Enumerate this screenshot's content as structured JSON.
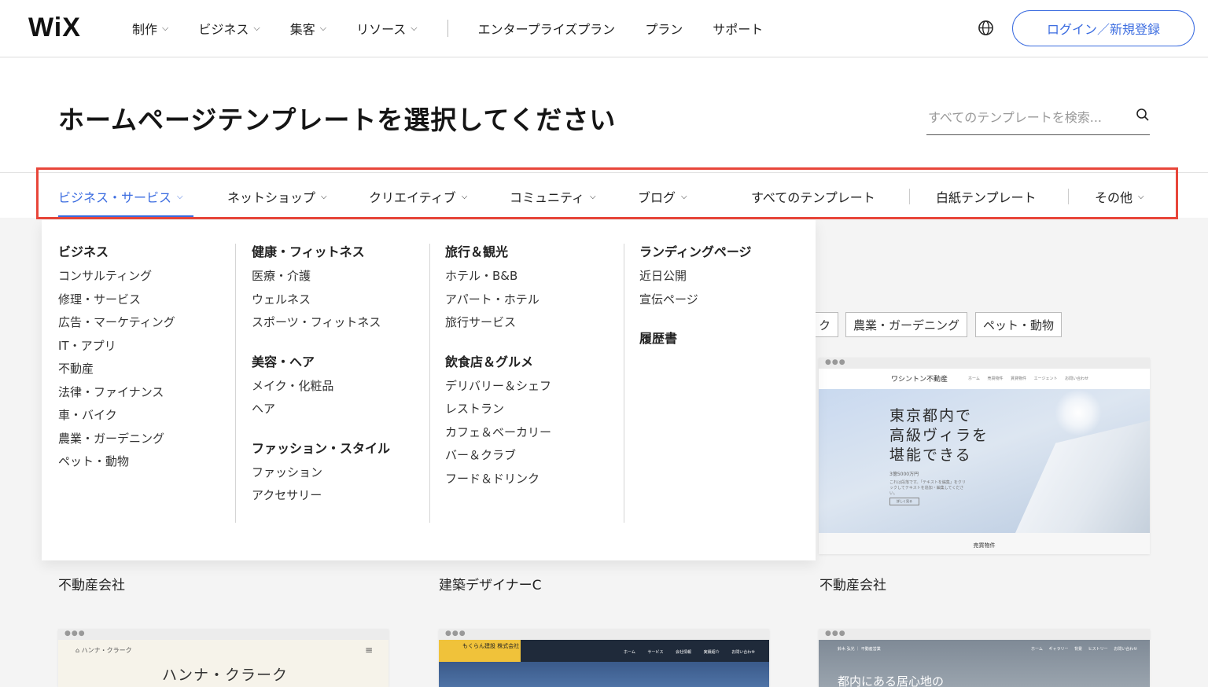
{
  "topbar": {
    "logo": "WiX",
    "nav": [
      {
        "label": "制作",
        "dropdown": true
      },
      {
        "label": "ビジネス",
        "dropdown": true
      },
      {
        "label": "集客",
        "dropdown": true
      },
      {
        "label": "リソース",
        "dropdown": true
      }
    ],
    "nav_right": [
      "エンタープライズプラン",
      "プラン",
      "サポート"
    ],
    "globe_icon": "globe-icon",
    "login_label": "ログイン／新規登録",
    "accent_color": "#3b6ce0"
  },
  "hero": {
    "title": "ホームページテンプレートを選択してください",
    "search_placeholder": "すべてのテンプレートを検索..."
  },
  "categories": {
    "items": [
      {
        "label": "ビジネス・サービス",
        "dropdown": true,
        "active": true
      },
      {
        "label": "ネットショップ",
        "dropdown": true
      },
      {
        "label": "クリエイティブ",
        "dropdown": true
      },
      {
        "label": "コミュニティ",
        "dropdown": true
      },
      {
        "label": "ブログ",
        "dropdown": true
      },
      {
        "label": "すべてのテンプレート"
      },
      {
        "label": "白紙テンプレート"
      },
      {
        "label": "その他",
        "dropdown": true
      }
    ],
    "highlight_color": "#e8463a"
  },
  "dropdown": {
    "col1": {
      "groups": [
        {
          "title": "ビジネス",
          "items": [
            "コンサルティング",
            "修理・サービス",
            "広告・マーケティング",
            "IT・アプリ",
            "不動産",
            "法律・ファイナンス",
            "車・バイク",
            "農業・ガーデニング",
            "ペット・動物"
          ]
        }
      ]
    },
    "col2": {
      "groups": [
        {
          "title": "健康・フィットネス",
          "items": [
            "医療・介護",
            "ウェルネス",
            "スポーツ・フィットネス"
          ]
        },
        {
          "title": "美容・ヘア",
          "items": [
            "メイク・化粧品",
            "ヘア"
          ]
        },
        {
          "title": "ファッション・スタイル",
          "items": [
            "ファッション",
            "アクセサリー"
          ]
        }
      ]
    },
    "col3": {
      "groups": [
        {
          "title": "旅行＆観光",
          "items": [
            "ホテル・B&B",
            "アパート・ホテル",
            "旅行サービス"
          ]
        },
        {
          "title": "飲食店＆グルメ",
          "items": [
            "デリバリー＆シェフ",
            "レストラン",
            "カフェ＆ベーカリー",
            "バー＆クラブ",
            "フード＆ドリンク"
          ]
        }
      ]
    },
    "col4": {
      "groups": [
        {
          "title": "ランディングページ",
          "items": [
            "近日公開",
            "宣伝ページ"
          ]
        },
        {
          "title": "履歴書",
          "items": []
        }
      ]
    }
  },
  "filter_tags": [
    "ク",
    "農業・ガーデニング",
    "ペット・動物"
  ],
  "templates": {
    "captions": [
      "不動産会社",
      "建築デザイナーC",
      "不動産会社"
    ],
    "main_card": {
      "brand": "ワシントン不動産",
      "nav": "ホーム 売買物件 賃貸物件 エージェント お問い合わせ",
      "headline_lines": [
        "東京都内で",
        "高級ヴィラを",
        "堪能できる"
      ],
      "price": "3億5000万円",
      "small_text": "これは段落です。「テキストを編集」をクリックしてテキストを追加・編集してください。",
      "button": "詳しく見る",
      "footer": "売買物件"
    },
    "bottom_cards": [
      {
        "brand": "ハンナ・クラーク",
        "title": "ハンナ・クラーク"
      },
      {
        "brand": "もくらん建設 株式会社",
        "nav": "ホーム サービス 会社情報 実績紹介 お問い合わせ"
      },
      {
        "brand": "鈴木 弘光 ｜ 不動産営業",
        "nav": "ホーム ギャラリー 背景 ヒストリー お問い合わせ",
        "title": "都内にある居心地の"
      }
    ]
  }
}
